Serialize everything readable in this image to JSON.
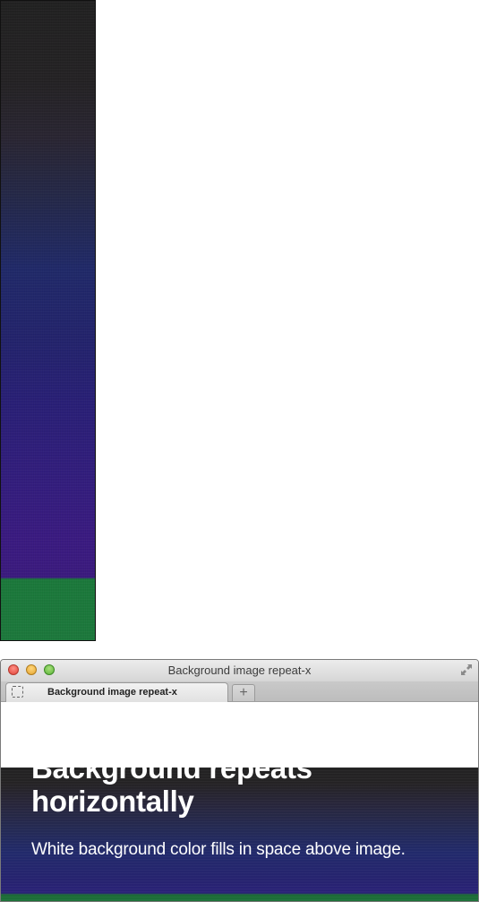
{
  "window": {
    "title": "Background image repeat-x"
  },
  "tabs": [
    {
      "label": "Background image repeat-x",
      "active": true
    }
  ],
  "new_tab_symbol": "+",
  "page": {
    "heading": "Background repeats horizontally",
    "text": "White background color fills in space above image."
  },
  "colors": {
    "page_background": "#ffffff",
    "heading_text": "#ffffff",
    "image_top": "#222222",
    "image_middle": "#2a2278",
    "image_bottom_band": "#1c7a3c"
  },
  "icons": {
    "close": "close-traffic-light-icon",
    "minimize": "minimize-traffic-light-icon",
    "zoom": "zoom-traffic-light-icon",
    "fullscreen": "fullscreen-arrows-icon",
    "favicon": "blank-page-favicon-icon",
    "new_tab": "plus-icon"
  }
}
